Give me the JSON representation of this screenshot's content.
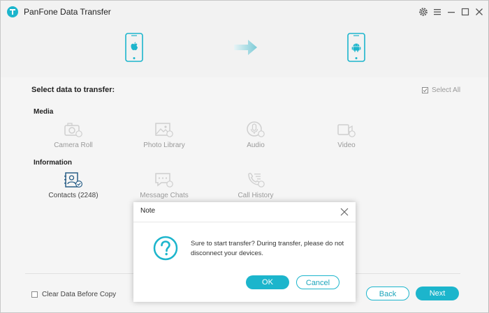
{
  "app": {
    "title": "PanFone Data Transfer"
  },
  "titlebar": {
    "icons": [
      "gear-icon",
      "menu-icon",
      "minimize-icon",
      "maximize-icon",
      "close-icon"
    ]
  },
  "devices": {
    "source": "iphone-icon",
    "target": "android-icon"
  },
  "main": {
    "select_label": "Select data to transfer:",
    "select_all_label": "Select All",
    "media_section": "Media",
    "information_section": "Information",
    "media_items": [
      {
        "label": "Camera Roll",
        "icon": "camera-icon"
      },
      {
        "label": "Photo Library",
        "icon": "photo-icon"
      },
      {
        "label": "Audio",
        "icon": "audio-icon"
      },
      {
        "label": "Video",
        "icon": "video-icon"
      }
    ],
    "information_items": [
      {
        "label": "Contacts (2248)",
        "icon": "contacts-icon"
      },
      {
        "label": "Message Chats",
        "icon": "message-icon"
      },
      {
        "label": "Call History",
        "icon": "call-history-icon"
      }
    ]
  },
  "footer": {
    "clear_data_label": "Clear Data Before Copy",
    "back_label": "Back",
    "next_label": "Next"
  },
  "dialog": {
    "title": "Note",
    "message": "Sure to start transfer? During transfer, please do not disconnect your devices.",
    "ok_label": "OK",
    "cancel_label": "Cancel"
  },
  "colors": {
    "accent": "#1cb5cc",
    "disabled": "#9a9a9a"
  }
}
